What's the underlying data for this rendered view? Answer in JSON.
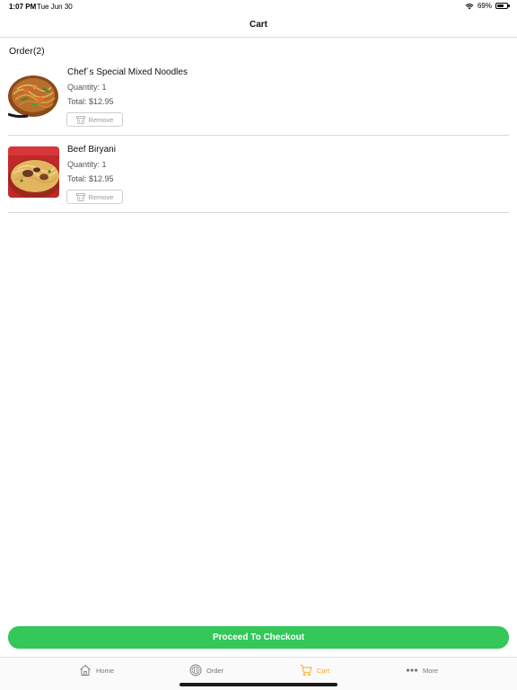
{
  "status_bar": {
    "time": "1:07 PM",
    "date": "Tue Jun 30",
    "battery_text": "69%",
    "battery_level": 0.69
  },
  "header": {
    "title": "Cart"
  },
  "cart": {
    "section_title": "Order(2)",
    "items": [
      {
        "name": "Chef´s Special Mixed Noodles",
        "quantity": "Quantity: 1",
        "total": "Total: $12.95",
        "remove_label": "Remove"
      },
      {
        "name": "Beef Biryani",
        "quantity": "Quantity: 1",
        "total": "Total: $12.95",
        "remove_label": "Remove"
      }
    ]
  },
  "checkout": {
    "label": "Proceed To Checkout"
  },
  "tab_bar": {
    "tabs": [
      {
        "label": "Home",
        "icon": "home-icon"
      },
      {
        "label": "Order",
        "icon": "dish-icon"
      },
      {
        "label": "Cart",
        "icon": "cart-icon",
        "active": true
      },
      {
        "label": "More",
        "icon": "more-dots-icon"
      }
    ]
  },
  "colors": {
    "accent": "#f5a623",
    "checkout": "#34c759"
  }
}
